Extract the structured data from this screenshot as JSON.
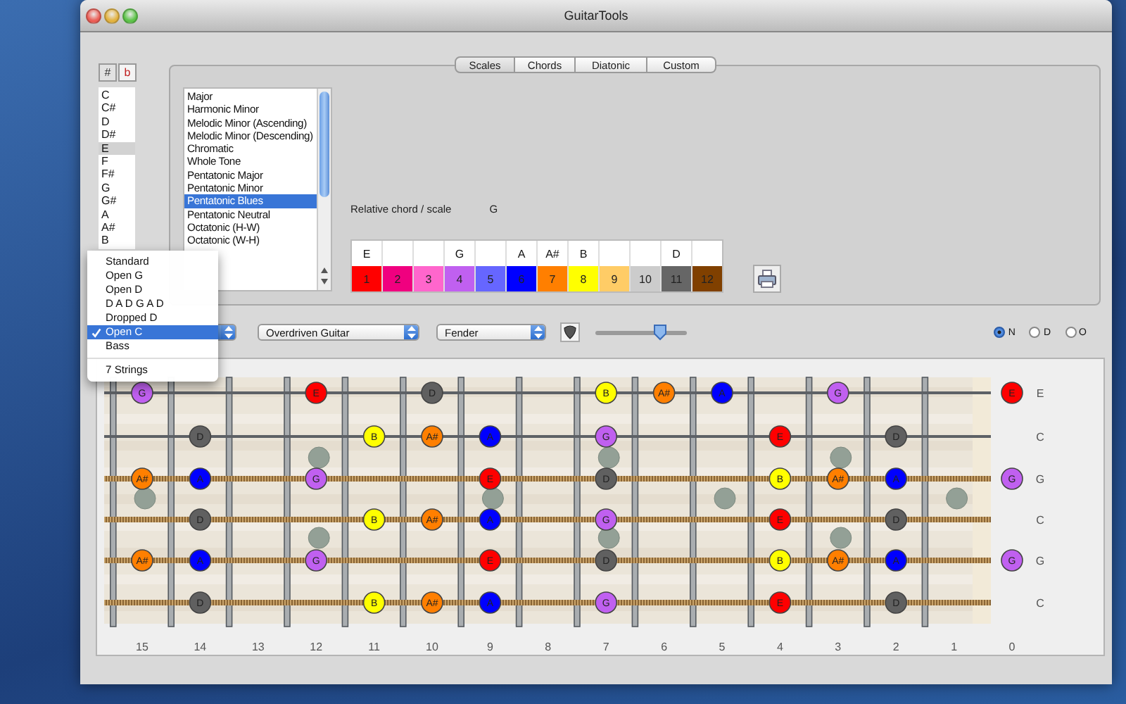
{
  "window": {
    "title": "GuitarTools"
  },
  "accidentals": [
    {
      "label": "#",
      "selected": true
    },
    {
      "label": "b",
      "selected": false
    }
  ],
  "keys": [
    {
      "label": "C",
      "selected": false
    },
    {
      "label": "C#",
      "selected": false
    },
    {
      "label": "D",
      "selected": false
    },
    {
      "label": "D#",
      "selected": false
    },
    {
      "label": "E",
      "selected": true
    },
    {
      "label": "F",
      "selected": false
    },
    {
      "label": "F#",
      "selected": false
    },
    {
      "label": "G",
      "selected": false
    },
    {
      "label": "G#",
      "selected": false
    },
    {
      "label": "A",
      "selected": false
    },
    {
      "label": "A#",
      "selected": false
    },
    {
      "label": "B",
      "selected": false
    }
  ],
  "tabs": [
    {
      "label": "Scales",
      "selected": true
    },
    {
      "label": "Chords",
      "selected": false
    },
    {
      "label": "Diatonic",
      "selected": false
    },
    {
      "label": "Custom",
      "selected": false
    }
  ],
  "scales": [
    {
      "label": "Major",
      "selected": false
    },
    {
      "label": "Harmonic Minor",
      "selected": false
    },
    {
      "label": "Melodic Minor (Ascending)",
      "selected": false
    },
    {
      "label": "Melodic Minor (Descending)",
      "selected": false
    },
    {
      "label": "Chromatic",
      "selected": false
    },
    {
      "label": "Whole Tone",
      "selected": false
    },
    {
      "label": "Pentatonic Major",
      "selected": false
    },
    {
      "label": "Pentatonic Minor",
      "selected": false
    },
    {
      "label": "Pentatonic Blues",
      "selected": true
    },
    {
      "label": "Pentatonic Neutral",
      "selected": false
    },
    {
      "label": "Octatonic (H-W)",
      "selected": false
    },
    {
      "label": "Octatonic (W-H)",
      "selected": false
    }
  ],
  "relative": {
    "label": "Relative chord / scale",
    "value": "G"
  },
  "palette": [
    {
      "note": "E",
      "number": "1",
      "color": "#ff0000"
    },
    {
      "number": "2",
      "color": "#f0007f"
    },
    {
      "number": "3",
      "color": "#ff66cc"
    },
    {
      "note": "G",
      "number": "4",
      "color": "#c060f0"
    },
    {
      "number": "5",
      "color": "#6666ff"
    },
    {
      "note": "A",
      "number": "6",
      "color": "#0000ff"
    },
    {
      "note": "A#",
      "number": "7",
      "color": "#ff7f00"
    },
    {
      "note": "B",
      "number": "8",
      "color": "#ffff00"
    },
    {
      "number": "9",
      "color": "#ffcc66"
    },
    {
      "number": "10",
      "color": "#cccccc"
    },
    {
      "note": "D",
      "number": "11",
      "color": "#666666"
    },
    {
      "number": "12",
      "color": "#804000"
    }
  ],
  "controls": {
    "sound": {
      "value": "Overdriven Guitar"
    },
    "model": {
      "value": "Fender"
    },
    "volume": {
      "level": 0.7
    },
    "display_mode": [
      {
        "label": "N",
        "selected": true
      },
      {
        "label": "D",
        "selected": false
      },
      {
        "label": "O",
        "selected": false
      }
    ]
  },
  "tuning_menu": [
    {
      "kind": "item",
      "label": "Standard",
      "checked": false
    },
    {
      "kind": "item",
      "label": "Open G",
      "checked": false
    },
    {
      "kind": "item",
      "label": "Open D",
      "checked": false
    },
    {
      "kind": "item",
      "label": "D A D G A D",
      "checked": false
    },
    {
      "kind": "item",
      "label": "Dropped D",
      "checked": false
    },
    {
      "kind": "item",
      "label": "Open C",
      "checked": true
    },
    {
      "kind": "item",
      "label": "Bass",
      "checked": false
    },
    {
      "kind": "separator"
    },
    {
      "kind": "item",
      "label": "7 Strings",
      "checked": false
    }
  ],
  "fretboard": {
    "frets": [
      {
        "label": "15",
        "kind": "single"
      },
      {
        "label": "14",
        "kind": "plain"
      },
      {
        "label": "13",
        "kind": "plain"
      },
      {
        "label": "12",
        "kind": "double"
      },
      {
        "label": "11",
        "kind": "plain"
      },
      {
        "label": "10",
        "kind": "plain"
      },
      {
        "label": "9",
        "kind": "single"
      },
      {
        "label": "8",
        "kind": "plain"
      },
      {
        "label": "7",
        "kind": "double"
      },
      {
        "label": "6",
        "kind": "plain"
      },
      {
        "label": "5",
        "kind": "single"
      },
      {
        "label": "4",
        "kind": "plain"
      },
      {
        "label": "3",
        "kind": "double"
      },
      {
        "label": "2",
        "kind": "plain"
      },
      {
        "label": "1",
        "kind": "single"
      },
      {
        "label": "0",
        "kind": "plain"
      }
    ],
    "strings": [
      {
        "tuning": "E",
        "wound": false,
        "cells": [
          {
            "note": "G",
            "color": "#c060f0"
          },
          null,
          null,
          {
            "note": "E",
            "color": "#ff0000"
          },
          null,
          {
            "note": "D",
            "color": "#606060"
          },
          null,
          null,
          {
            "note": "B",
            "color": "#ffff00"
          },
          {
            "note": "A#",
            "color": "#ff7f00"
          },
          {
            "note": "A",
            "color": "#0000ff"
          },
          null,
          {
            "note": "G",
            "color": "#c060f0"
          },
          null,
          null,
          {
            "note": "E",
            "color": "#ff0000"
          }
        ]
      },
      {
        "tuning": "C",
        "wound": false,
        "cells": [
          null,
          {
            "note": "D",
            "color": "#606060"
          },
          null,
          null,
          {
            "note": "B",
            "color": "#ffff00"
          },
          {
            "note": "A#",
            "color": "#ff7f00"
          },
          {
            "note": "A",
            "color": "#0000ff"
          },
          null,
          {
            "note": "G",
            "color": "#c060f0"
          },
          null,
          null,
          {
            "note": "E",
            "color": "#ff0000"
          },
          null,
          {
            "note": "D",
            "color": "#606060"
          },
          null,
          null
        ]
      },
      {
        "tuning": "G",
        "wound": true,
        "cells": [
          {
            "note": "A#",
            "color": "#ff7f00"
          },
          {
            "note": "A",
            "color": "#0000ff"
          },
          null,
          {
            "note": "G",
            "color": "#c060f0"
          },
          null,
          null,
          {
            "note": "E",
            "color": "#ff0000"
          },
          null,
          {
            "note": "D",
            "color": "#606060"
          },
          null,
          null,
          {
            "note": "B",
            "color": "#ffff00"
          },
          {
            "note": "A#",
            "color": "#ff7f00"
          },
          {
            "note": "A",
            "color": "#0000ff"
          },
          null,
          {
            "note": "G",
            "color": "#c060f0"
          }
        ]
      },
      {
        "tuning": "C",
        "wound": true,
        "cells": [
          null,
          {
            "note": "D",
            "color": "#606060"
          },
          null,
          null,
          {
            "note": "B",
            "color": "#ffff00"
          },
          {
            "note": "A#",
            "color": "#ff7f00"
          },
          {
            "note": "A",
            "color": "#0000ff"
          },
          null,
          {
            "note": "G",
            "color": "#c060f0"
          },
          null,
          null,
          {
            "note": "E",
            "color": "#ff0000"
          },
          null,
          {
            "note": "D",
            "color": "#606060"
          },
          null,
          null
        ]
      },
      {
        "tuning": "G",
        "wound": true,
        "cells": [
          {
            "note": "A#",
            "color": "#ff7f00"
          },
          {
            "note": "A",
            "color": "#0000ff"
          },
          null,
          {
            "note": "G",
            "color": "#c060f0"
          },
          null,
          null,
          {
            "note": "E",
            "color": "#ff0000"
          },
          null,
          {
            "note": "D",
            "color": "#606060"
          },
          null,
          null,
          {
            "note": "B",
            "color": "#ffff00"
          },
          {
            "note": "A#",
            "color": "#ff7f00"
          },
          {
            "note": "A",
            "color": "#0000ff"
          },
          null,
          {
            "note": "G",
            "color": "#c060f0"
          }
        ]
      },
      {
        "tuning": "C",
        "wound": true,
        "cells": [
          null,
          {
            "note": "D",
            "color": "#606060"
          },
          null,
          null,
          {
            "note": "B",
            "color": "#ffff00"
          },
          {
            "note": "A#",
            "color": "#ff7f00"
          },
          {
            "note": "A",
            "color": "#0000ff"
          },
          null,
          {
            "note": "G",
            "color": "#c060f0"
          },
          null,
          null,
          {
            "note": "E",
            "color": "#ff0000"
          },
          null,
          {
            "note": "D",
            "color": "#606060"
          },
          null,
          null
        ]
      }
    ]
  }
}
